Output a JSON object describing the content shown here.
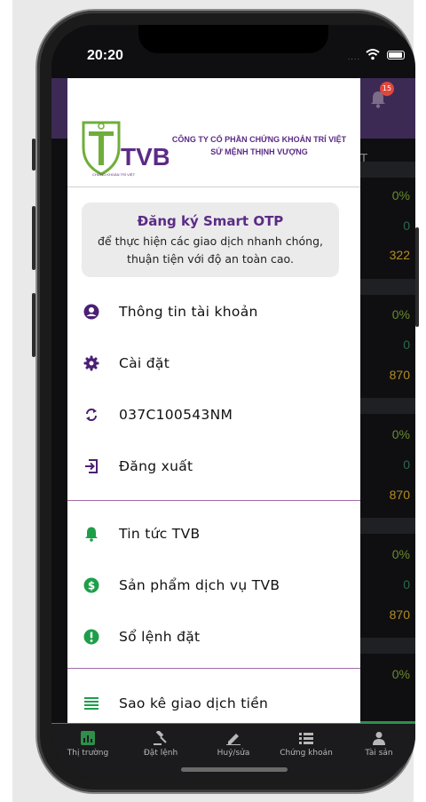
{
  "status": {
    "time": "20:20",
    "signal": "...."
  },
  "background": {
    "notification_count": "15",
    "tab_fragment": "T",
    "rows": [
      {
        "pct": "0%",
        "zero": "0",
        "price": "322"
      },
      {
        "pct": "0%",
        "zero": "0",
        "price": "870"
      },
      {
        "pct": "0%",
        "zero": "0",
        "price": "870"
      },
      {
        "pct": "0%",
        "zero": "0",
        "price": "870"
      },
      {
        "pct": "0%"
      }
    ]
  },
  "drawer": {
    "logo_text": "TVB",
    "logo_small": "CHỨNG KHOÁN TRÍ VIỆT",
    "company_name": "CÔNG TY CỔ PHẦN CHỨNG KHOÁN TRÍ VIỆT",
    "slogan": "SỨ MỆNH THỊNH VƯỢNG",
    "otp": {
      "title": "Đăng ký Smart OTP",
      "line1": "để thực hiện các giao dịch nhanh chóng,",
      "line2": "thuận tiện với độ an toàn cao."
    },
    "menu": [
      {
        "label": "Thông tin tài khoản",
        "icon": "account-circle-icon"
      },
      {
        "label": "Cài đặt",
        "icon": "gear-icon"
      },
      {
        "label": "037C100543NM",
        "icon": "sync-icon"
      },
      {
        "label": "Đăng xuất",
        "icon": "logout-icon"
      },
      {
        "label": "Tin tức TVB",
        "icon": "bell-icon"
      },
      {
        "label": "Sản phẩm dịch vụ TVB",
        "icon": "dollar-circle-icon"
      },
      {
        "label": "Sổ lệnh đặt",
        "icon": "alert-circle-icon"
      },
      {
        "label": "Sao kê giao dịch tiền",
        "icon": "list-icon"
      }
    ],
    "colors": {
      "brand_purple": "#5b2b86",
      "icon_purple": "#4b1f74",
      "icon_green": "#1f9e4a",
      "divider": "#a36aa8"
    }
  },
  "bottom_nav": [
    {
      "label": "Thị trường",
      "icon": "chart-icon"
    },
    {
      "label": "Đặt lệnh",
      "icon": "gavel-icon"
    },
    {
      "label": "Huỷ/sửa",
      "icon": "pencil-icon"
    },
    {
      "label": "Chứng khoán",
      "icon": "list-icon"
    },
    {
      "label": "Tài sản",
      "icon": "person-icon"
    }
  ]
}
